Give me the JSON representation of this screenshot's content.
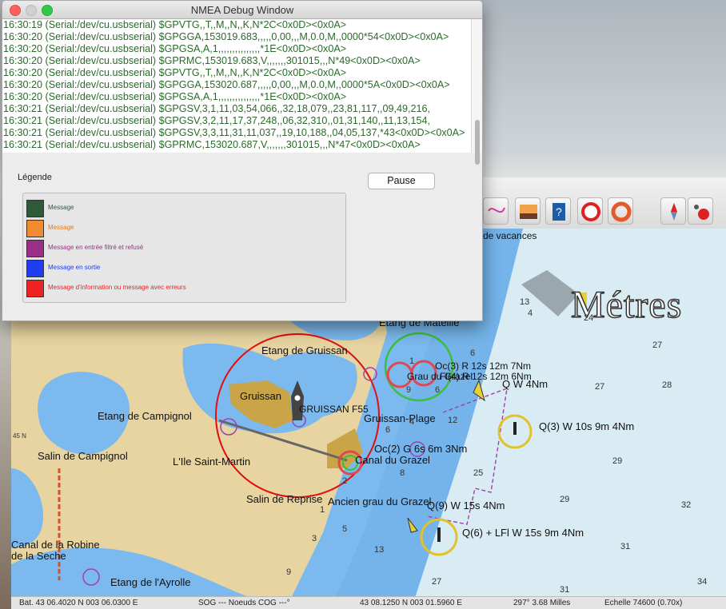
{
  "debug_window": {
    "title": "NMEA Debug Window",
    "log_lines": [
      "16:30:19 (Serial:/dev/cu.usbserial) $GPVTG,,T,,M,,N,,K,N*2C<0x0D><0x0A>",
      "16:30:20 (Serial:/dev/cu.usbserial) $GPGGA,153019.683,,,,,0,00,,,M,0.0,M,,0000*54<0x0D><0x0A>",
      "16:30:20 (Serial:/dev/cu.usbserial) $GPGSA,A,1,,,,,,,,,,,,,,,*1E<0x0D><0x0A>",
      "16:30:20 (Serial:/dev/cu.usbserial) $GPRMC,153019.683,V,,,,,,,301015,,,N*49<0x0D><0x0A>",
      "16:30:20 (Serial:/dev/cu.usbserial) $GPVTG,,T,,M,,N,,K,N*2C<0x0D><0x0A>",
      "16:30:20 (Serial:/dev/cu.usbserial) $GPGGA,153020.687,,,,,0,00,,,M,0.0,M,,0000*5A<0x0D><0x0A>",
      "16:30:20 (Serial:/dev/cu.usbserial) $GPGSA,A,1,,,,,,,,,,,,,,,*1E<0x0D><0x0A>",
      "16:30:21 (Serial:/dev/cu.usbserial) $GPGSV,3,1,11,03,54,066,,32,18,079,,23,81,117,,09,49,216,",
      "16:30:21 (Serial:/dev/cu.usbserial) $GPGSV,3,2,11,17,37,248,,06,32,310,,01,31,140,,11,13,154,",
      "16:30:21 (Serial:/dev/cu.usbserial) $GPGSV,3,3,11,31,11,037,,19,10,188,,04,05,137,*43<0x0D><0x0A>",
      "16:30:21 (Serial:/dev/cu.usbserial) $GPRMC,153020.687,V,,,,,,,301015,,,N*47<0x0D><0x0A>"
    ],
    "legend_title": "Légende",
    "pause_label": "Pause",
    "legend": [
      {
        "label": "Message",
        "color": "#2e5a3a",
        "text_color": "#2e5a3a"
      },
      {
        "label": "Message",
        "color": "#f28b30",
        "text_color": "#e07a20"
      },
      {
        "label": "Message en entrée filtré et refusé",
        "color": "#9b2f87",
        "text_color": "#9b2f87"
      },
      {
        "label": "Message en sortie",
        "color": "#1f3df0",
        "text_color": "#1f3df0"
      },
      {
        "label": "Message d'information ou message avec erreurs",
        "color": "#ee2222",
        "text_color": "#ee2222"
      }
    ]
  },
  "toolbar": {
    "tools": [
      "zoom-in-icon",
      "zoom-out-icon",
      "scale-down-icon",
      "scale-up-icon",
      "route-icon",
      "ship-icon",
      "wrench-icon",
      "text-add-icon",
      "measure-icon",
      "water-level-icon",
      "tide-icon",
      "print-icon",
      "graph-icon",
      "track-icon",
      "sunset-icon",
      "help-icon",
      "mob-icon",
      "lifebuoy-icon",
      "compass-icon",
      "record-icon"
    ]
  },
  "map": {
    "overlay_text": "Métres",
    "top_label": "de vacances",
    "places": {
      "etang_mateille": "Etang de Mateille",
      "etang_gruissan": "Etang de Gruissan",
      "gruissan": "Gruissan",
      "gruissan_f55": "GRUISSAN F55",
      "gruissan_plage": "Gruissan-Plage",
      "etang_campignol": "Etang de Campignol",
      "salin_campignol": "Salin de Campignol",
      "ile_saint_martin": "L'Ile Saint-Martin",
      "salin_reprise": "Salin de Reprise",
      "ancien_grau": "Ancien grau du Grazel",
      "canal_grazel": "Canal du Grazel",
      "etang_robine": "Canal de la Robine",
      "seche": "de la Seche",
      "etang_ayrolle": "Etang de l'Ayrolle",
      "grazel_label": "Grau du Grazel",
      "n45": "45 N"
    },
    "lights": {
      "l1": "Q W 4Nm",
      "l2": "Q(3) W 10s 9m 4Nm",
      "l3": "Q(9) W 15s 4Nm",
      "l4": "Q(6) + LFl W 15s 9m 4Nm",
      "l5": "Oc(2) G 6s 6m 3Nm",
      "l6": "Oc(3) R 12s 12m 7Nm",
      "l7": "Fl(4) R 12s 12m 6Nm"
    },
    "depths": [
      "13",
      "24",
      "27",
      "29",
      "28",
      "27",
      "32",
      "25",
      "12",
      "6",
      "29",
      "4",
      "32",
      "31",
      "27",
      "34",
      "31",
      "13",
      "5",
      "8",
      "9",
      "1",
      "3",
      "6",
      "4",
      "2",
      "9",
      "1",
      "6"
    ]
  },
  "status": {
    "position": "Bat. 43 06.4020 N   003 06.0300 E",
    "sog_cog": "SOG --- Noeuds  COG ---°",
    "cursor": "43 08.1250 N    003 01.5960 E",
    "bearing": "297°  3.68 Milles",
    "scale": "Echelle 74600 (0.70x)"
  }
}
